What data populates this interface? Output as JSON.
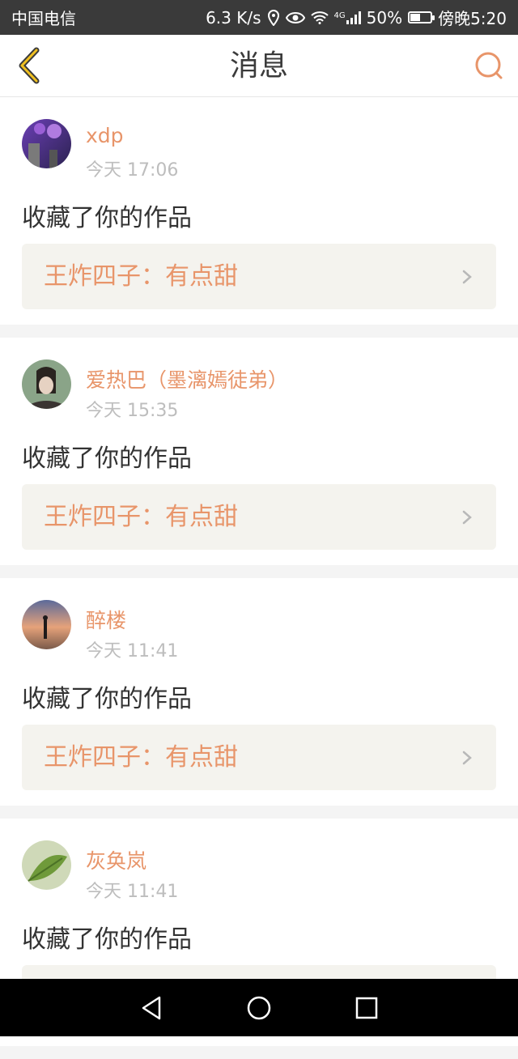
{
  "status_bar": {
    "carrier": "中国电信",
    "speed": "6.3 K/s",
    "network": "4G",
    "battery": "50%",
    "battery_level": 0.5,
    "time": "傍晚5:20"
  },
  "header": {
    "title": "消息",
    "back_icon": "chevron-left-icon",
    "search_icon": "search-icon",
    "accent_color": "#e8956a"
  },
  "messages": [
    {
      "username": "xdp",
      "time": "今天 17:06",
      "action": "收藏了你的作品",
      "work_title": "王炸四子：有点甜"
    },
    {
      "username": "爱热巴（墨漓嫣徒弟）",
      "time": "今天 15:35",
      "action": "收藏了你的作品",
      "work_title": "王炸四子：有点甜"
    },
    {
      "username": "醉楼",
      "time": "今天 11:41",
      "action": "收藏了你的作品",
      "work_title": "王炸四子：有点甜"
    },
    {
      "username": "灰奂岚",
      "time": "今天 11:41",
      "action": "收藏了你的作品",
      "work_title": ""
    }
  ],
  "nav_bar": {
    "back_icon": "triangle-back-icon",
    "home_icon": "circle-home-icon",
    "recents_icon": "square-recents-icon"
  }
}
